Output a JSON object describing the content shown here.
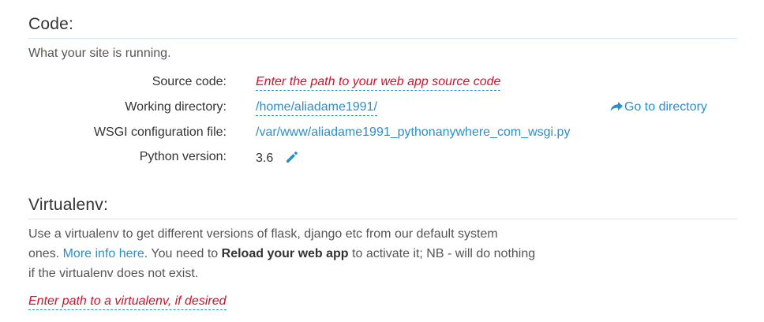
{
  "code_section": {
    "title": "Code:",
    "description": "What your site is running.",
    "source_code": {
      "label": "Source code:",
      "placeholder": "Enter the path to your web app source code"
    },
    "working_directory": {
      "label": "Working directory:",
      "value": "/home/aliadame1991/",
      "goto_label": "Go to directory",
      "goto_icon": "share-arrow-icon"
    },
    "wsgi": {
      "label": "WSGI configuration file:",
      "value": "/var/www/aliadame1991_pythonanywhere_com_wsgi.py"
    },
    "python_version": {
      "label": "Python version:",
      "value": "3.6",
      "edit_icon": "pencil-icon"
    }
  },
  "virtualenv_section": {
    "title": "Virtualenv:",
    "desc_part1": "Use a virtualenv to get different versions of flask, django etc from our default system",
    "desc_part2a": "ones.",
    "more_info_link": "More info here",
    "desc_part2b": ". You need to",
    "reload_bold": "Reload your web app",
    "desc_part2c": "to activate it; NB - will do nothing",
    "desc_part3": "if the virtualenv does not exist.",
    "path_placeholder": "Enter path to a virtualenv, if desired"
  },
  "colors": {
    "link": "#2a8fc9",
    "empty_placeholder": "#d0112b",
    "rule": "#cfe4ee",
    "text": "#333333"
  }
}
